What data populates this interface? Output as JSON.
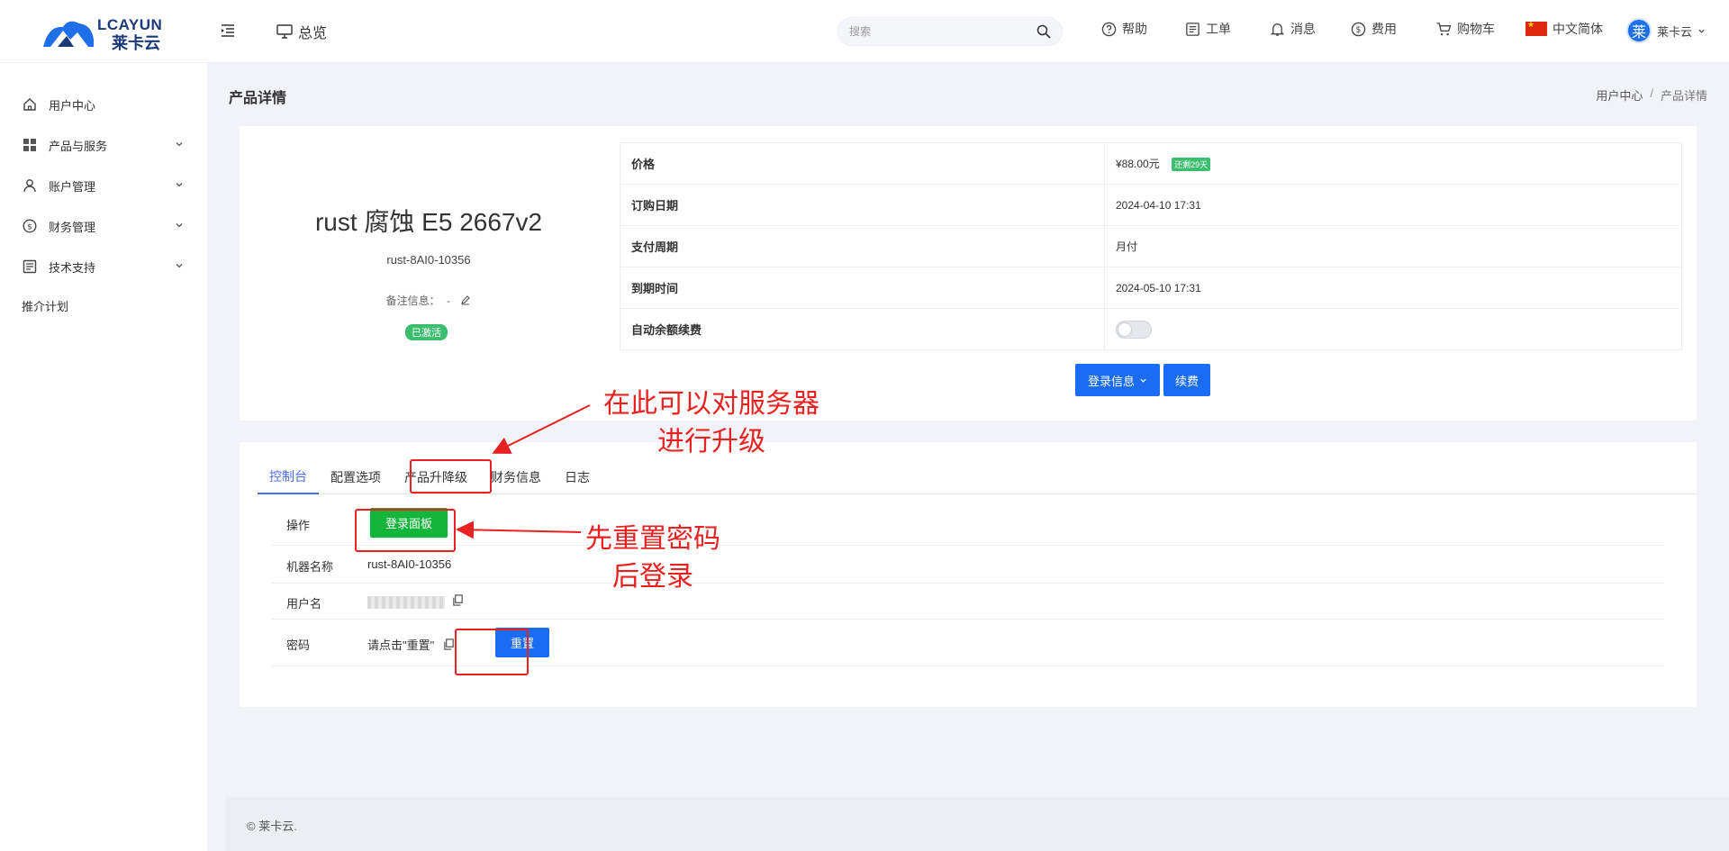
{
  "header": {
    "logo_text": "LCAYUN",
    "logo_sub": "莱卡云",
    "overview": "总览",
    "search_placeholder": "搜索",
    "help": "帮助",
    "ticket": "工单",
    "message": "消息",
    "cost": "费用",
    "cart": "购物车",
    "language": "中文简体",
    "user_avatar": "莱",
    "user_name": "莱卡云"
  },
  "sidebar": {
    "items": [
      {
        "label": "用户中心",
        "icon": "home-icon"
      },
      {
        "label": "产品与服务",
        "icon": "grid-icon"
      },
      {
        "label": "账户管理",
        "icon": "user-icon"
      },
      {
        "label": "财务管理",
        "icon": "dollar-icon"
      },
      {
        "label": "技术支持",
        "icon": "document-icon"
      }
    ],
    "referral": "推介计划"
  },
  "page": {
    "title": "产品详情",
    "breadcrumb": [
      "用户中心",
      "产品详情"
    ]
  },
  "product": {
    "name": "rust 腐蚀 E5 2667v2",
    "id": "rust-8AI0-10356",
    "remark_label": "备注信息：",
    "remark_value": "-",
    "status": "已激活"
  },
  "info": {
    "price_label": "价格",
    "price_value": "¥88.00元",
    "remain": "还剩29天",
    "order_date_label": "订购日期",
    "order_date_value": "2024-04-10 17:31",
    "cycle_label": "支付周期",
    "cycle_value": "月付",
    "expire_label": "到期时间",
    "expire_value": "2024-05-10 17:31",
    "auto_renew_label": "自动余额续费"
  },
  "actions": {
    "login_info": "登录信息",
    "renew": "续费"
  },
  "tabs": [
    "控制台",
    "配置选项",
    "产品升降级",
    "财务信息",
    "日志"
  ],
  "console": {
    "operation_label": "操作",
    "login_panel": "登录面板",
    "machine_label": "机器名称",
    "machine_value": "rust-8AI0-10356",
    "username_label": "用户名",
    "password_label": "密码",
    "password_hint": "请点击\"重置\"",
    "reset": "重置"
  },
  "annotations": {
    "upgrade_line1": "在此可以对服务器",
    "upgrade_line2": "进行升级",
    "reset_line1": "先重置密码",
    "reset_line2": "后登录"
  },
  "footer": "© 莱卡云.",
  "colors": {
    "primary": "#1a6cf2",
    "success": "#13b53a",
    "annotation": "#e82121",
    "tab_active": "#4b6cf0"
  }
}
